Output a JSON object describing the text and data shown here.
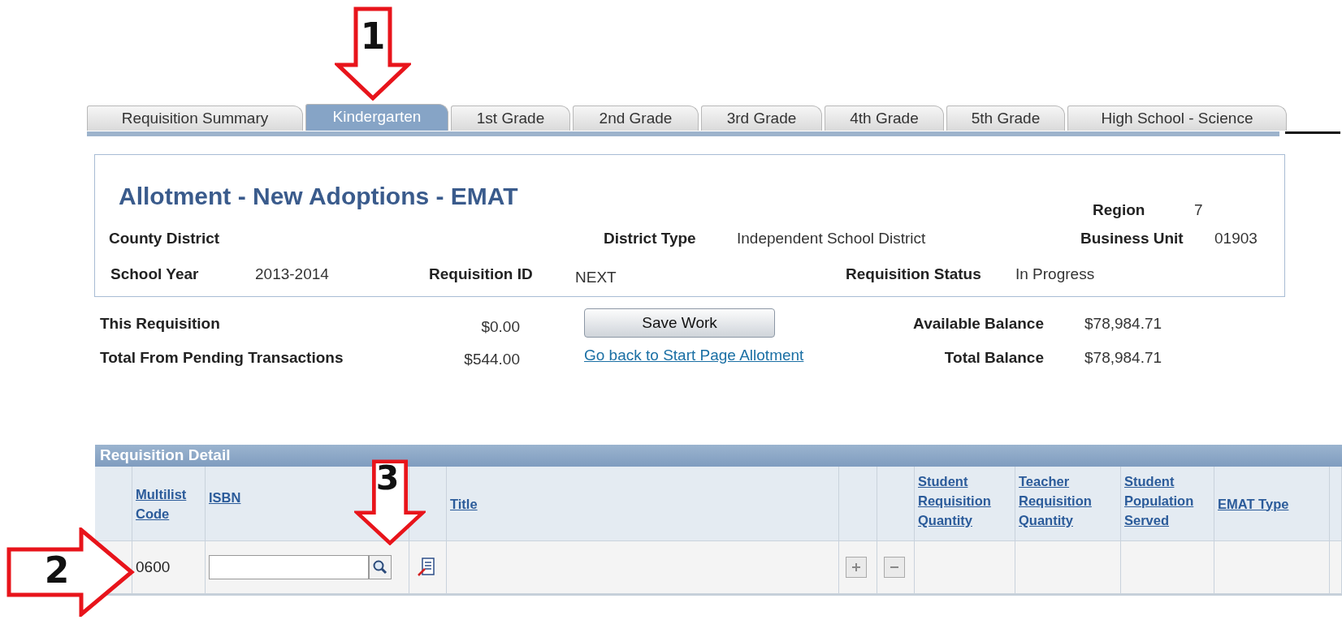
{
  "annotations": [
    {
      "label": "1",
      "kind": "down"
    },
    {
      "label": "2",
      "kind": "right"
    },
    {
      "label": "3",
      "kind": "down"
    }
  ],
  "tabs": [
    {
      "label": "Requisition Summary",
      "selected": false
    },
    {
      "label": "Kindergarten",
      "selected": true
    },
    {
      "label": "1st Grade",
      "selected": false
    },
    {
      "label": "2nd Grade",
      "selected": false
    },
    {
      "label": "3rd Grade",
      "selected": false
    },
    {
      "label": "4th Grade",
      "selected": false
    },
    {
      "label": "5th Grade",
      "selected": false
    },
    {
      "label": "High School - Science",
      "selected": false
    }
  ],
  "header": {
    "title": "Allotment - New Adoptions - EMAT",
    "region": {
      "label": "Region",
      "value": "7"
    },
    "county_district": {
      "label": "County District"
    },
    "district_type": {
      "label": "District Type",
      "value": "Independent School District"
    },
    "business_unit": {
      "label": "Business Unit",
      "value": "01903"
    },
    "school_year": {
      "label": "School Year",
      "value": "2013-2014"
    },
    "requisition_id": {
      "label": "Requisition ID",
      "value": "NEXT"
    },
    "requisition_status": {
      "label": "Requisition Status",
      "value": "In Progress"
    }
  },
  "totals": {
    "this_requisition": {
      "label": "This Requisition",
      "value": "$0.00"
    },
    "pending": {
      "label": "Total From Pending Transactions",
      "value": "$544.00"
    },
    "save_button": "Save Work",
    "back_link": "Go back to Start Page Allotment",
    "available_balance": {
      "label": "Available Balance",
      "value": "$78,984.71"
    },
    "total_balance": {
      "label": "Total Balance",
      "value": "$78,984.71"
    }
  },
  "grid": {
    "title": "Requisition Detail",
    "columns": [
      "Multilist Code",
      "ISBN",
      "Title",
      "Student Requisition Quantity",
      "Teacher Requisition Quantity",
      "Student Population Served",
      "EMAT Type"
    ],
    "rows": [
      {
        "multilist_code": "0600"
      }
    ]
  }
}
